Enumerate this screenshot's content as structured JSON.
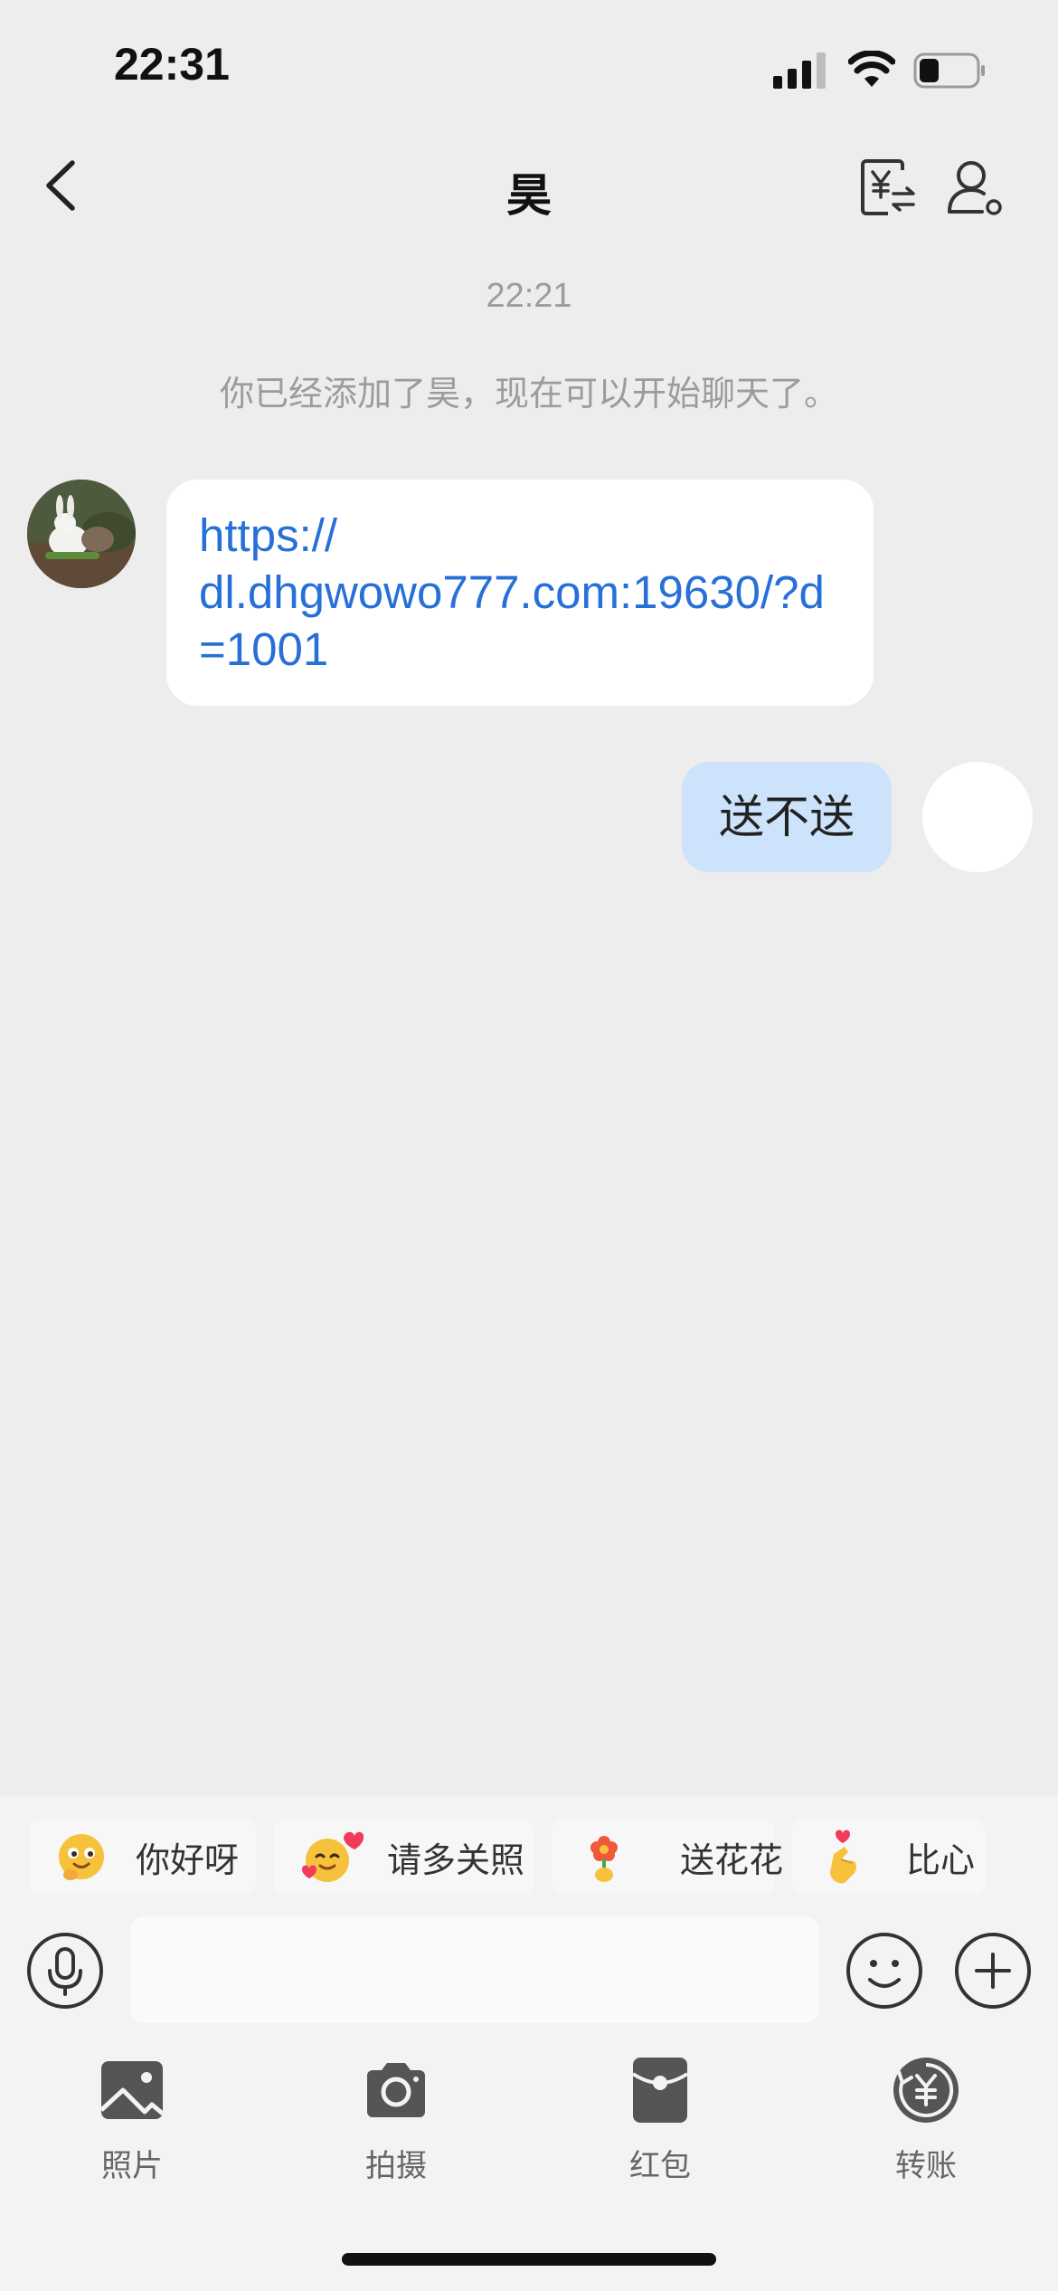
{
  "status_bar": {
    "time": "22:31",
    "battery_level": 0.35
  },
  "header": {
    "title": "昊"
  },
  "chat": {
    "timestamp": "22:21",
    "system_message": "你已经添加了昊，现在可以开始聊天了。",
    "messages": [
      {
        "sender": "contact",
        "text": "https://\ndl.dhgwowo777.com:19630/?d=1001"
      },
      {
        "sender": "me",
        "text": "送不送"
      }
    ]
  },
  "quick_replies": [
    {
      "label": "你好呀",
      "icon": "smiling-face-emoji"
    },
    {
      "label": "请多关照",
      "icon": "hugging-face-heart-emoji"
    },
    {
      "label": "送花花",
      "icon": "flower-emoji"
    },
    {
      "label": "比心",
      "icon": "finger-heart-emoji"
    }
  ],
  "input": {
    "placeholder": "",
    "value": ""
  },
  "toolbar": [
    {
      "label": "照片",
      "icon": "photo-icon"
    },
    {
      "label": "拍摄",
      "icon": "camera-icon"
    },
    {
      "label": "红包",
      "icon": "red-packet-icon"
    },
    {
      "label": "转账",
      "icon": "transfer-icon"
    }
  ],
  "colors": {
    "link": "#2770d8",
    "my_bubble": "#cde3fb",
    "background": "#ededed"
  }
}
